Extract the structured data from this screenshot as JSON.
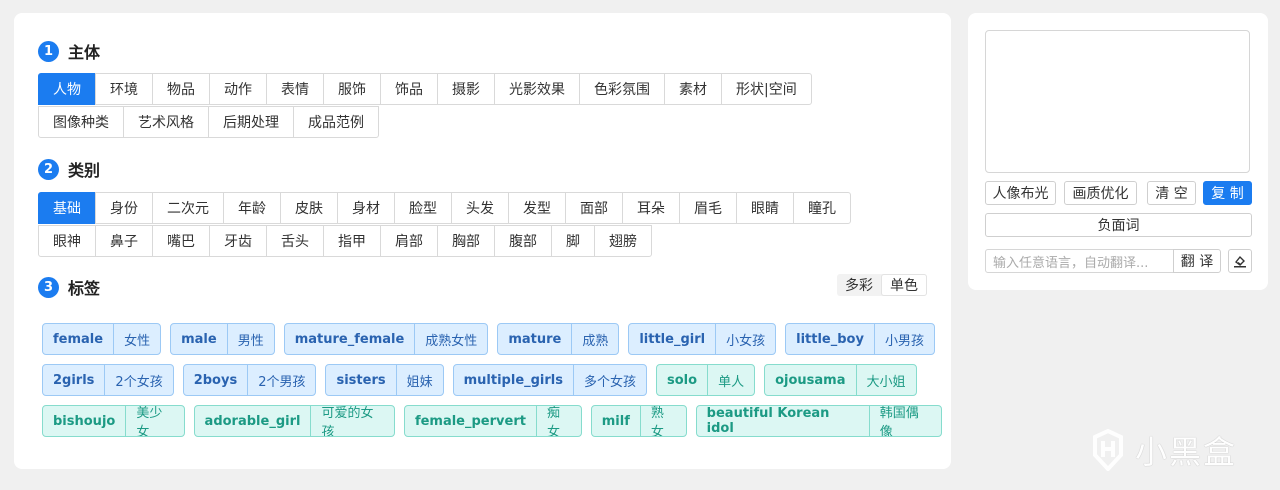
{
  "sections": [
    {
      "num": "1",
      "title": "主体"
    },
    {
      "num": "2",
      "title": "类别"
    },
    {
      "num": "3",
      "title": "标签"
    }
  ],
  "subject_tabs": {
    "row1": [
      "人物",
      "环境",
      "物品",
      "动作",
      "表情",
      "服饰",
      "饰品",
      "摄影",
      "光影效果",
      "色彩氛围",
      "素材",
      "形状|空间"
    ],
    "row2": [
      "图像种类",
      "艺术风格",
      "后期处理",
      "成品范例"
    ],
    "active": "人物"
  },
  "category_tabs": {
    "row1": [
      "基础",
      "身份",
      "二次元",
      "年龄",
      "皮肤",
      "身材",
      "脸型",
      "头发",
      "发型",
      "面部",
      "耳朵",
      "眉毛",
      "眼睛",
      "瞳孔"
    ],
    "row2": [
      "眼神",
      "鼻子",
      "嘴巴",
      "牙齿",
      "舌头",
      "指甲",
      "肩部",
      "胸部",
      "腹部",
      "脚",
      "翅膀"
    ],
    "active": "基础"
  },
  "color_mode": {
    "multi": "多彩",
    "single": "单色",
    "selected": "单色"
  },
  "tags": [
    [
      {
        "en": "female",
        "zh": "女性",
        "color": "blue"
      },
      {
        "en": "male",
        "zh": "男性",
        "color": "blue"
      },
      {
        "en": "mature_female",
        "zh": "成熟女性",
        "color": "blue"
      },
      {
        "en": "mature",
        "zh": "成熟",
        "color": "blue"
      },
      {
        "en": "little_girl",
        "zh": "小女孩",
        "color": "blue"
      },
      {
        "en": "little_boy",
        "zh": "小男孩",
        "color": "blue"
      }
    ],
    [
      {
        "en": "2girls",
        "zh": "2个女孩",
        "color": "blue"
      },
      {
        "en": "2boys",
        "zh": "2个男孩",
        "color": "blue"
      },
      {
        "en": "sisters",
        "zh": "姐妹",
        "color": "blue"
      },
      {
        "en": "multiple_girls",
        "zh": "多个女孩",
        "color": "blue"
      },
      {
        "en": "solo",
        "zh": "单人",
        "color": "teal"
      },
      {
        "en": "ojousama",
        "zh": "大小姐",
        "color": "teal"
      }
    ],
    [
      {
        "en": "bishoujo",
        "zh": "美少女",
        "color": "teal"
      },
      {
        "en": "adorable_girl",
        "zh": "可爱的女孩",
        "color": "teal"
      },
      {
        "en": "female_pervert",
        "zh": "痴女",
        "color": "teal"
      },
      {
        "en": "milf",
        "zh": "熟女",
        "color": "teal"
      },
      {
        "en": "beautiful Korean idol",
        "zh": "韩国偶像",
        "color": "teal"
      }
    ]
  ],
  "side": {
    "portrait_light": "人像布光",
    "quality_opt": "画质优化",
    "clear": "清 空",
    "copy": "复 制",
    "negative": "负面词",
    "translate_placeholder": "输入任意语言，自动翻译...",
    "translate": "翻 译"
  },
  "watermark": "小黑盒",
  "colors": {
    "accent": "#1b7cf0",
    "tag_blue": "#dceeff",
    "tag_teal": "#dcf7f3"
  }
}
